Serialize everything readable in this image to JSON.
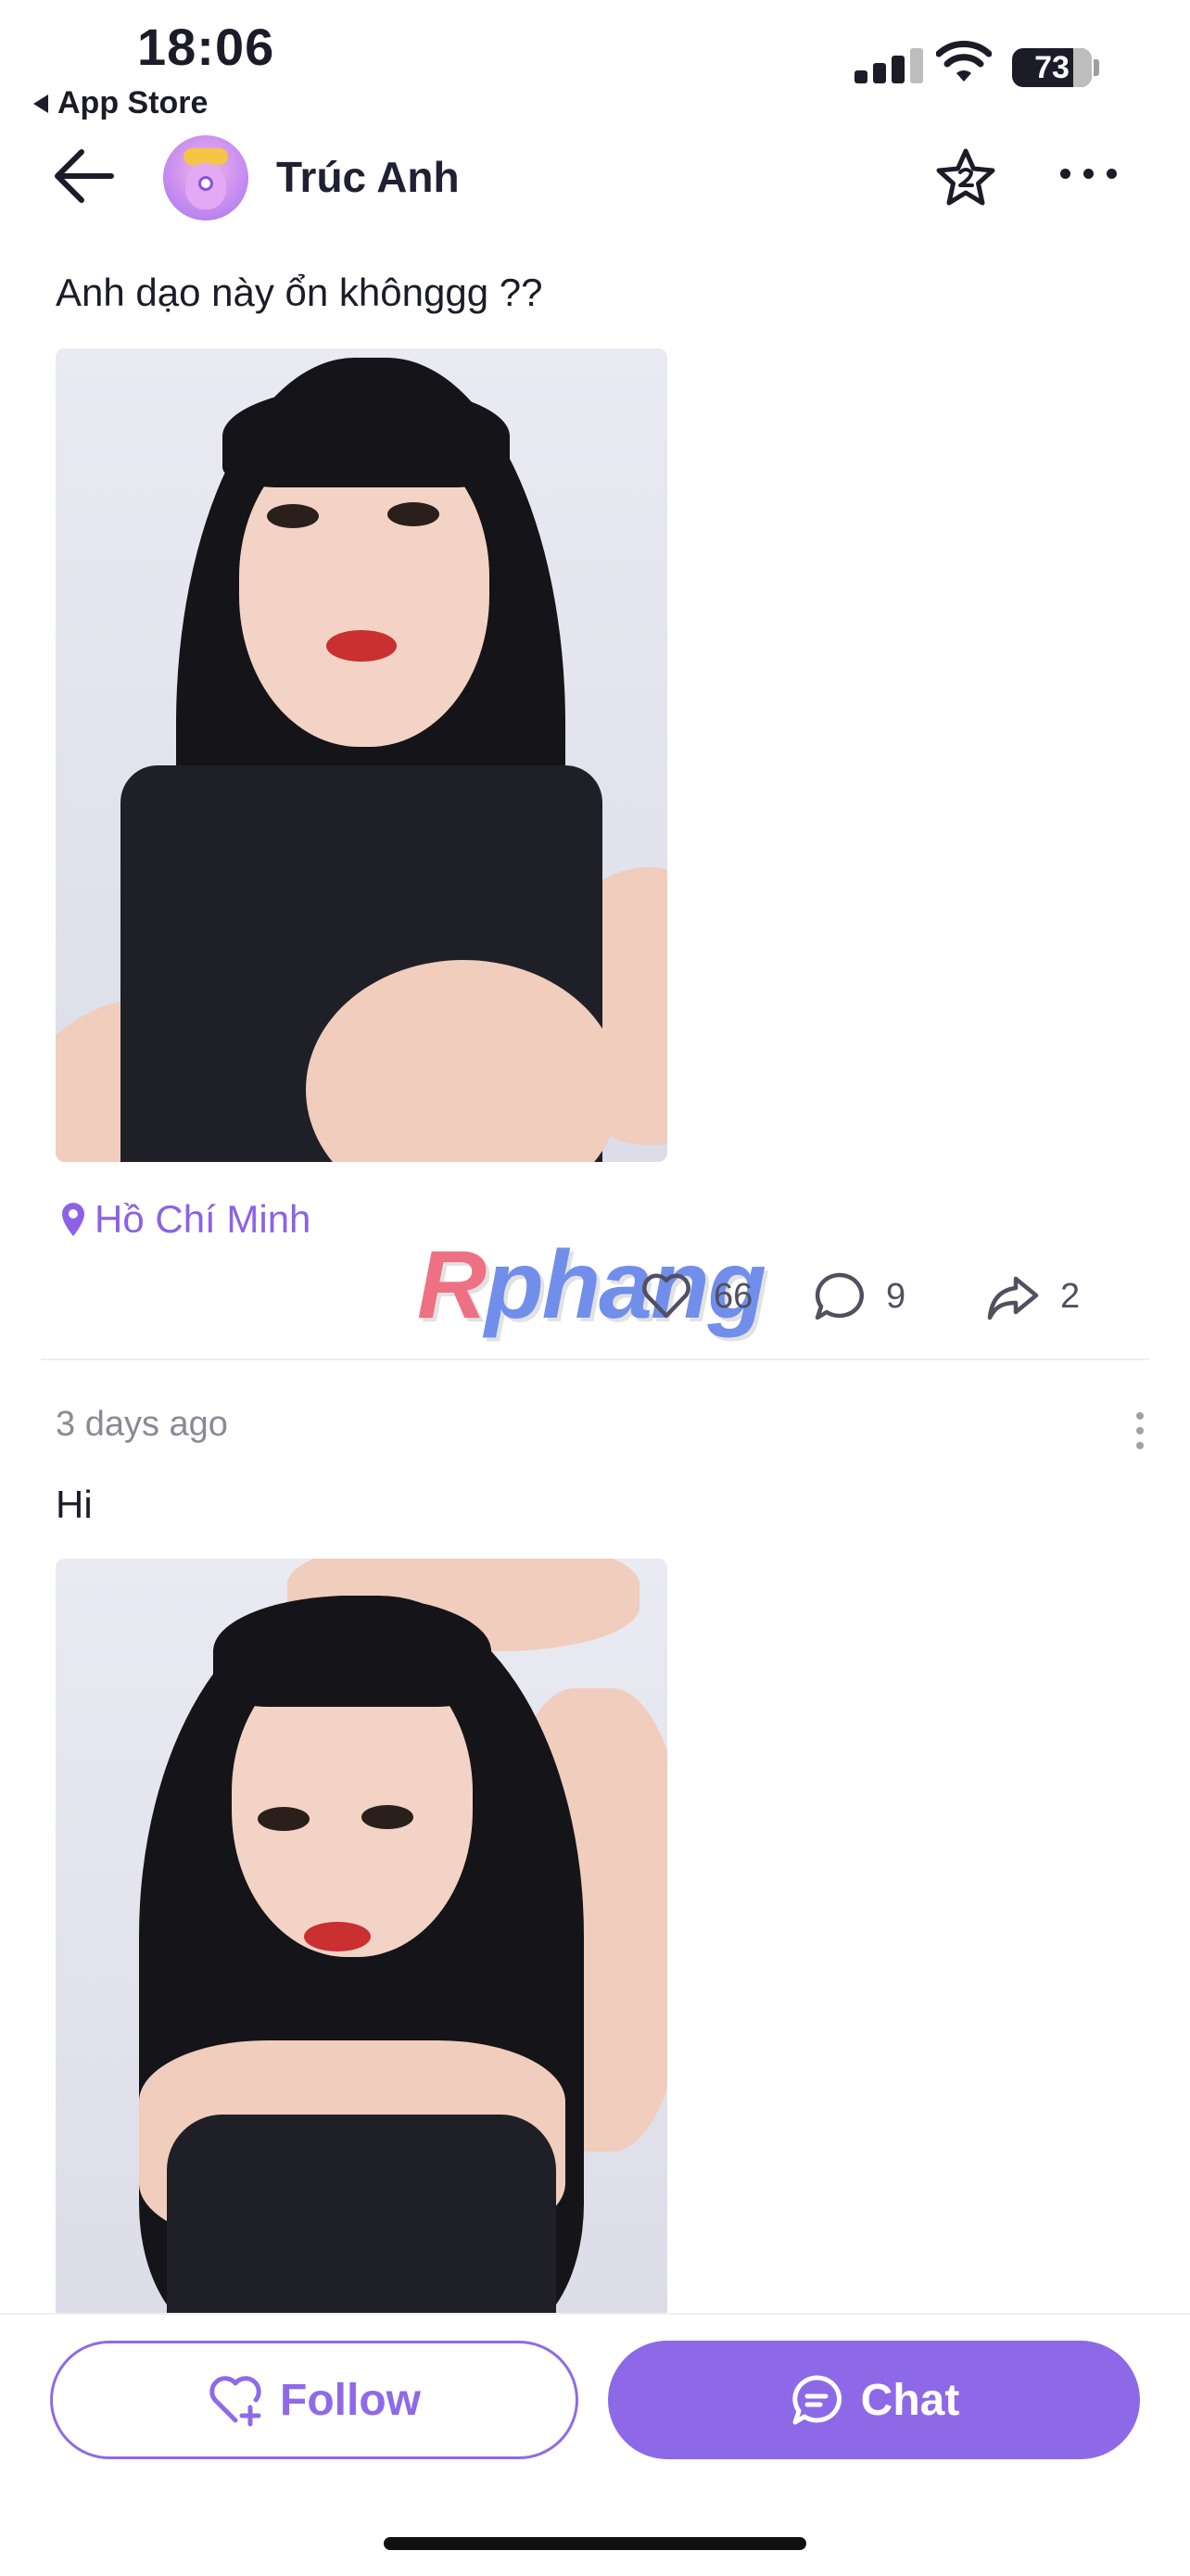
{
  "status_bar": {
    "time": "18:06",
    "back_app_label": "App Store",
    "battery_level": "73"
  },
  "header": {
    "profile_name": "Trúc Anh",
    "icons": [
      "back-arrow-icon",
      "avatar",
      "star-icon",
      "more-icon"
    ]
  },
  "posts": [
    {
      "text": "Anh dạo này ổn khônggg ??",
      "location": "Hồ Chí Minh",
      "likes": "66",
      "comments": "9",
      "shares": "2"
    },
    {
      "timestamp": "3 days ago",
      "text": "Hi"
    }
  ],
  "watermark": {
    "letter": "R",
    "rest": "phang"
  },
  "bottom_bar": {
    "follow_label": "Follow",
    "chat_label": "Chat"
  },
  "colors": {
    "accent": "#8d69e8",
    "location": "#8b62e6",
    "text": "#1c1c28",
    "muted": "#8a8a96"
  }
}
